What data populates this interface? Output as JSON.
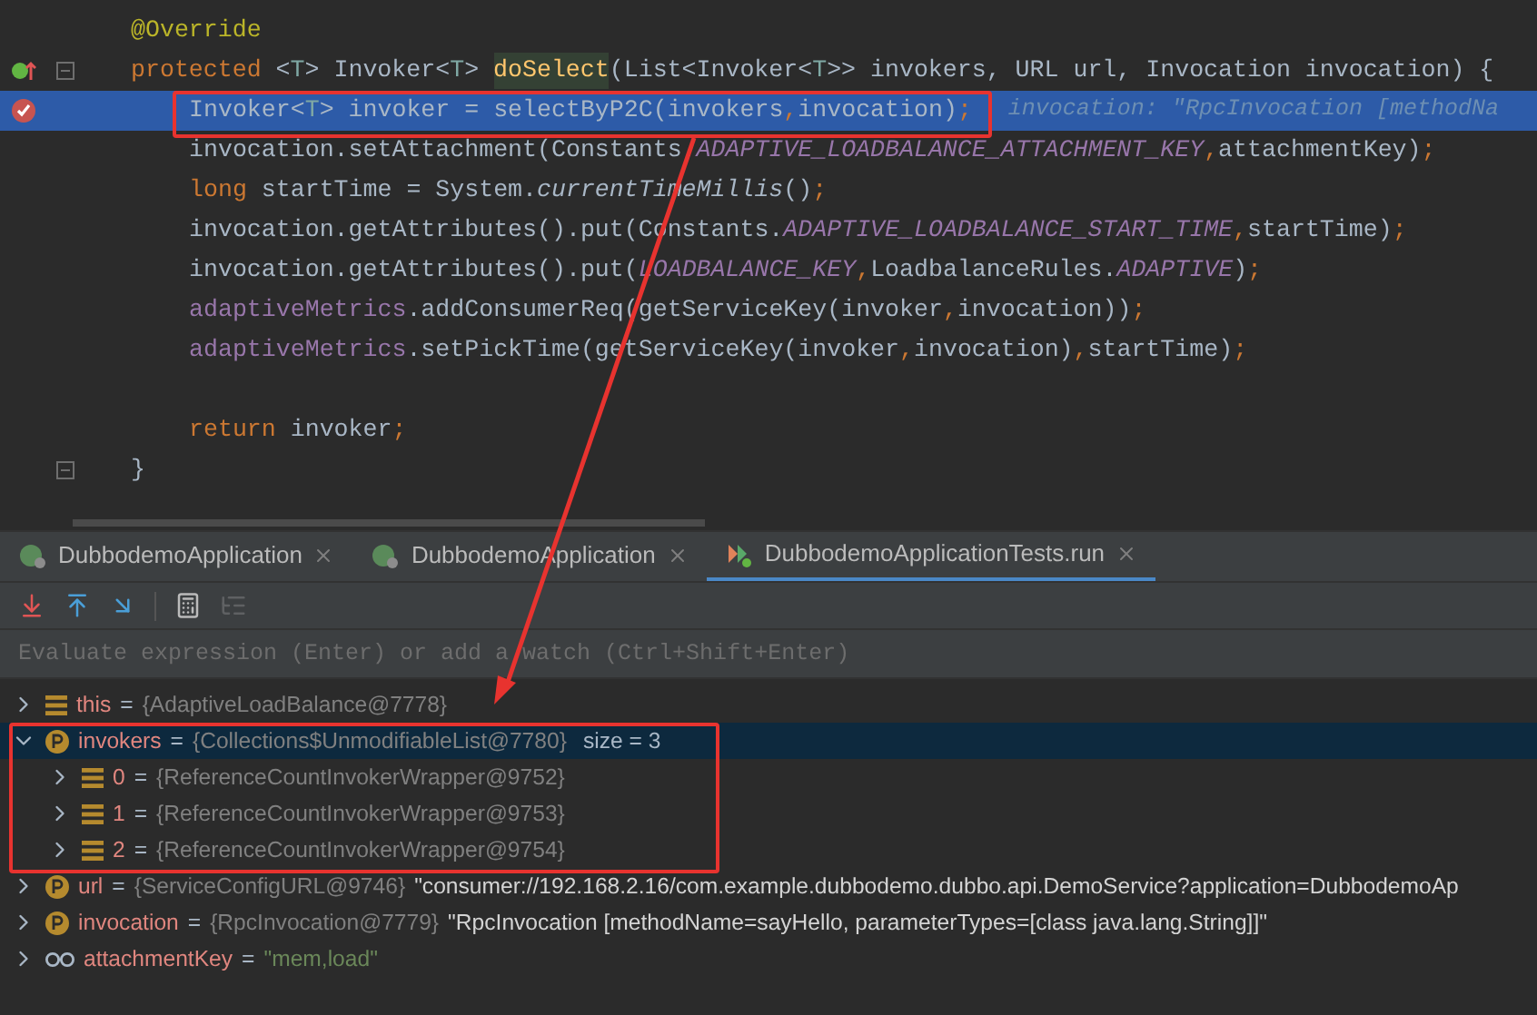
{
  "editor": {
    "lines": [
      {
        "selected": false,
        "kind": "member",
        "breakpoint": false,
        "override_marker": false,
        "fold": false,
        "tokens": [
          {
            "text": "@Override",
            "kind": "anno"
          }
        ]
      },
      {
        "selected": false,
        "kind": "member",
        "breakpoint": false,
        "override_marker": true,
        "fold": true,
        "tokens": [
          {
            "text": "protected",
            "kind": "kw"
          },
          {
            "text": " <",
            "kind": "plain"
          },
          {
            "text": "T",
            "kind": "tparam"
          },
          {
            "text": "> Invoker<",
            "kind": "plain"
          },
          {
            "text": "T",
            "kind": "tparam"
          },
          {
            "text": "> ",
            "kind": "plain"
          },
          {
            "text": "doSelect",
            "kind": "decl"
          },
          {
            "text": "(List<Invoker<",
            "kind": "plain"
          },
          {
            "text": "T",
            "kind": "tparam"
          },
          {
            "text": ">> invokers, URL url, Invocation invocation) {",
            "kind": "plain"
          }
        ]
      },
      {
        "selected": true,
        "kind": "body",
        "breakpoint": true,
        "override_marker": false,
        "fold": false,
        "tokens": [
          {
            "text": "Invoker<",
            "kind": "plain"
          },
          {
            "text": "T",
            "kind": "tparam"
          },
          {
            "text": "> invoker = selectByP2C(invokers",
            "kind": "plain"
          },
          {
            "text": ",",
            "kind": "punct"
          },
          {
            "text": "invocation)",
            "kind": "plain"
          },
          {
            "text": ";",
            "kind": "punct"
          },
          {
            "text": "invocation: \"RpcInvocation [methodNa",
            "kind": "hint"
          }
        ]
      },
      {
        "selected": false,
        "kind": "body",
        "breakpoint": false,
        "override_marker": false,
        "fold": false,
        "tokens": [
          {
            "text": "invocation.setAttachment(Constants.",
            "kind": "plain"
          },
          {
            "text": "ADAPTIVE_LOADBALANCE_ATTACHMENT_KEY",
            "kind": "const"
          },
          {
            "text": ",",
            "kind": "punct"
          },
          {
            "text": "attachmentKey)",
            "kind": "plain"
          },
          {
            "text": ";",
            "kind": "punct"
          }
        ]
      },
      {
        "selected": false,
        "kind": "body",
        "breakpoint": false,
        "override_marker": false,
        "fold": false,
        "tokens": [
          {
            "text": "long",
            "kind": "kw"
          },
          {
            "text": " startTime = System.",
            "kind": "plain"
          },
          {
            "text": "currentTimeMillis",
            "kind": "static"
          },
          {
            "text": "()",
            "kind": "plain"
          },
          {
            "text": ";",
            "kind": "punct"
          }
        ]
      },
      {
        "selected": false,
        "kind": "body",
        "breakpoint": false,
        "override_marker": false,
        "fold": false,
        "tokens": [
          {
            "text": "invocation.getAttributes().put(Constants.",
            "kind": "plain"
          },
          {
            "text": "ADAPTIVE_LOADBALANCE_START_TIME",
            "kind": "const"
          },
          {
            "text": ",",
            "kind": "punct"
          },
          {
            "text": "startTime)",
            "kind": "plain"
          },
          {
            "text": ";",
            "kind": "punct"
          }
        ]
      },
      {
        "selected": false,
        "kind": "body",
        "breakpoint": false,
        "override_marker": false,
        "fold": false,
        "tokens": [
          {
            "text": "invocation.getAttributes().put(",
            "kind": "plain"
          },
          {
            "text": "LOADBALANCE_KEY",
            "kind": "const"
          },
          {
            "text": ",",
            "kind": "punct"
          },
          {
            "text": "LoadbalanceRules.",
            "kind": "plain"
          },
          {
            "text": "ADAPTIVE",
            "kind": "const"
          },
          {
            "text": ")",
            "kind": "plain"
          },
          {
            "text": ";",
            "kind": "punct"
          }
        ]
      },
      {
        "selected": false,
        "kind": "body",
        "breakpoint": false,
        "override_marker": false,
        "fold": false,
        "tokens": [
          {
            "text": "adaptiveMetrics",
            "kind": "field"
          },
          {
            "text": ".addConsumerReq(getServiceKey(invoker",
            "kind": "plain"
          },
          {
            "text": ",",
            "kind": "punct"
          },
          {
            "text": "invocation))",
            "kind": "plain"
          },
          {
            "text": ";",
            "kind": "punct"
          }
        ]
      },
      {
        "selected": false,
        "kind": "body",
        "breakpoint": false,
        "override_marker": false,
        "fold": false,
        "tokens": [
          {
            "text": "adaptiveMetrics",
            "kind": "field"
          },
          {
            "text": ".setPickTime(getServiceKey(invoker",
            "kind": "plain"
          },
          {
            "text": ",",
            "kind": "punct"
          },
          {
            "text": "invocation)",
            "kind": "plain"
          },
          {
            "text": ",",
            "kind": "punct"
          },
          {
            "text": "startTime)",
            "kind": "plain"
          },
          {
            "text": ";",
            "kind": "punct"
          }
        ]
      },
      {
        "selected": false,
        "kind": "blank",
        "breakpoint": false,
        "override_marker": false,
        "fold": false
      },
      {
        "selected": false,
        "kind": "body",
        "breakpoint": false,
        "override_marker": false,
        "fold": false,
        "tokens": [
          {
            "text": "return",
            "kind": "kw"
          },
          {
            "text": " invoker",
            "kind": "plain"
          },
          {
            "text": ";",
            "kind": "punct"
          }
        ]
      },
      {
        "selected": false,
        "kind": "member",
        "breakpoint": false,
        "override_marker": false,
        "fold": true,
        "tokens": [
          {
            "text": "}",
            "kind": "plain"
          }
        ]
      }
    ]
  },
  "tabs": [
    {
      "label": "DubbodemoApplication",
      "selected": false,
      "kind": "app"
    },
    {
      "label": "DubbodemoApplication",
      "selected": false,
      "kind": "app"
    },
    {
      "label": "DubbodemoApplicationTests.run",
      "selected": true,
      "kind": "test"
    }
  ],
  "watch_field": {
    "placeholder": "Evaluate expression (Enter) or add a watch (Ctrl+Shift+Enter)"
  },
  "variables": [
    {
      "kind": "array",
      "name": "this",
      "operator": "=",
      "value": "{AdaptiveLoadBalance@7778}",
      "expanded": false,
      "selected": false
    },
    {
      "kind": "field",
      "name": "invokers",
      "operator": "=",
      "value": "{Collections$UnmodifiableList@7780}",
      "extra": "size = 3",
      "expanded": true,
      "selected": true,
      "children": [
        {
          "kind": "array",
          "name": "0",
          "operator": "=",
          "value": "{ReferenceCountInvokerWrapper@9752}",
          "expanded": false,
          "selected": false
        },
        {
          "kind": "array",
          "name": "1",
          "operator": "=",
          "value": "{ReferenceCountInvokerWrapper@9753}",
          "expanded": false,
          "selected": false
        },
        {
          "kind": "array",
          "name": "2",
          "operator": "=",
          "value": "{ReferenceCountInvokerWrapper@9754}",
          "expanded": false,
          "selected": false
        }
      ]
    },
    {
      "kind": "field",
      "name": "url",
      "operator": "=",
      "value": "{ServiceConfigURL@9746}",
      "string": "\"consumer://192.168.2.16/com.example.dubbodemo.dubbo.api.DemoService?application=DubbodemoAp",
      "expanded": false,
      "selected": false
    },
    {
      "kind": "field",
      "name": "invocation",
      "operator": "=",
      "value": "{RpcInvocation@7779}",
      "string": "\"RpcInvocation [methodName=sayHello, parameterTypes=[class java.lang.String]]\"",
      "expanded": false,
      "selected": false
    },
    {
      "kind": "watch",
      "name": "attachmentKey",
      "operator": "=",
      "literal": "\"mem,load\"",
      "expanded": false,
      "selected": false
    }
  ]
}
